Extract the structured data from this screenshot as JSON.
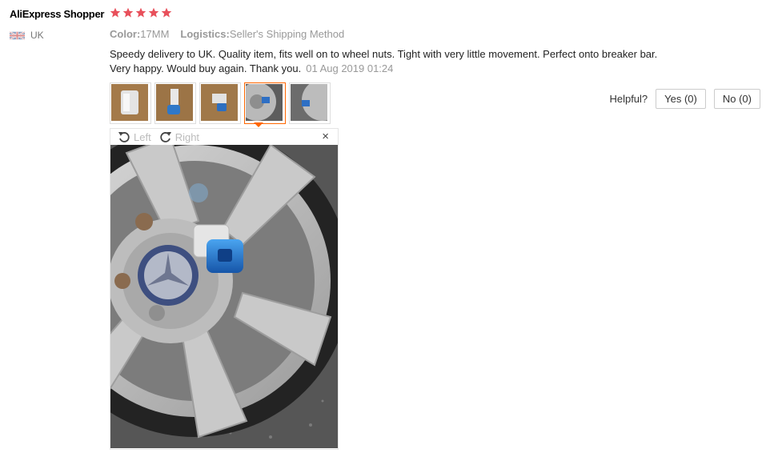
{
  "review": {
    "user_name": "AliExpress Shopper",
    "rating": 5,
    "country": "UK",
    "color_label": "Color:",
    "color_value": "17MM",
    "logistics_label": "Logistics:",
    "logistics_value": "Seller's Shipping Method",
    "text": "Speedy delivery to UK. Quality item, fits well on to wheel nuts. Tight with very little movement. Perfect onto breaker bar. Very happy. Would buy again. Thank you.",
    "date": "01 Aug 2019 01:24"
  },
  "helpful": {
    "label": "Helpful?",
    "yes_label": "Yes (0)",
    "no_label": "No (0)"
  },
  "viewer": {
    "rotate_left_label": "Left",
    "rotate_right_label": "Right",
    "close_glyph": "×"
  },
  "colors": {
    "star": "#e8505b",
    "accent": "#ff6600"
  },
  "icons": [
    "star-icon",
    "uk-flag-icon",
    "rotate-left-icon",
    "rotate-right-icon",
    "close-icon"
  ]
}
